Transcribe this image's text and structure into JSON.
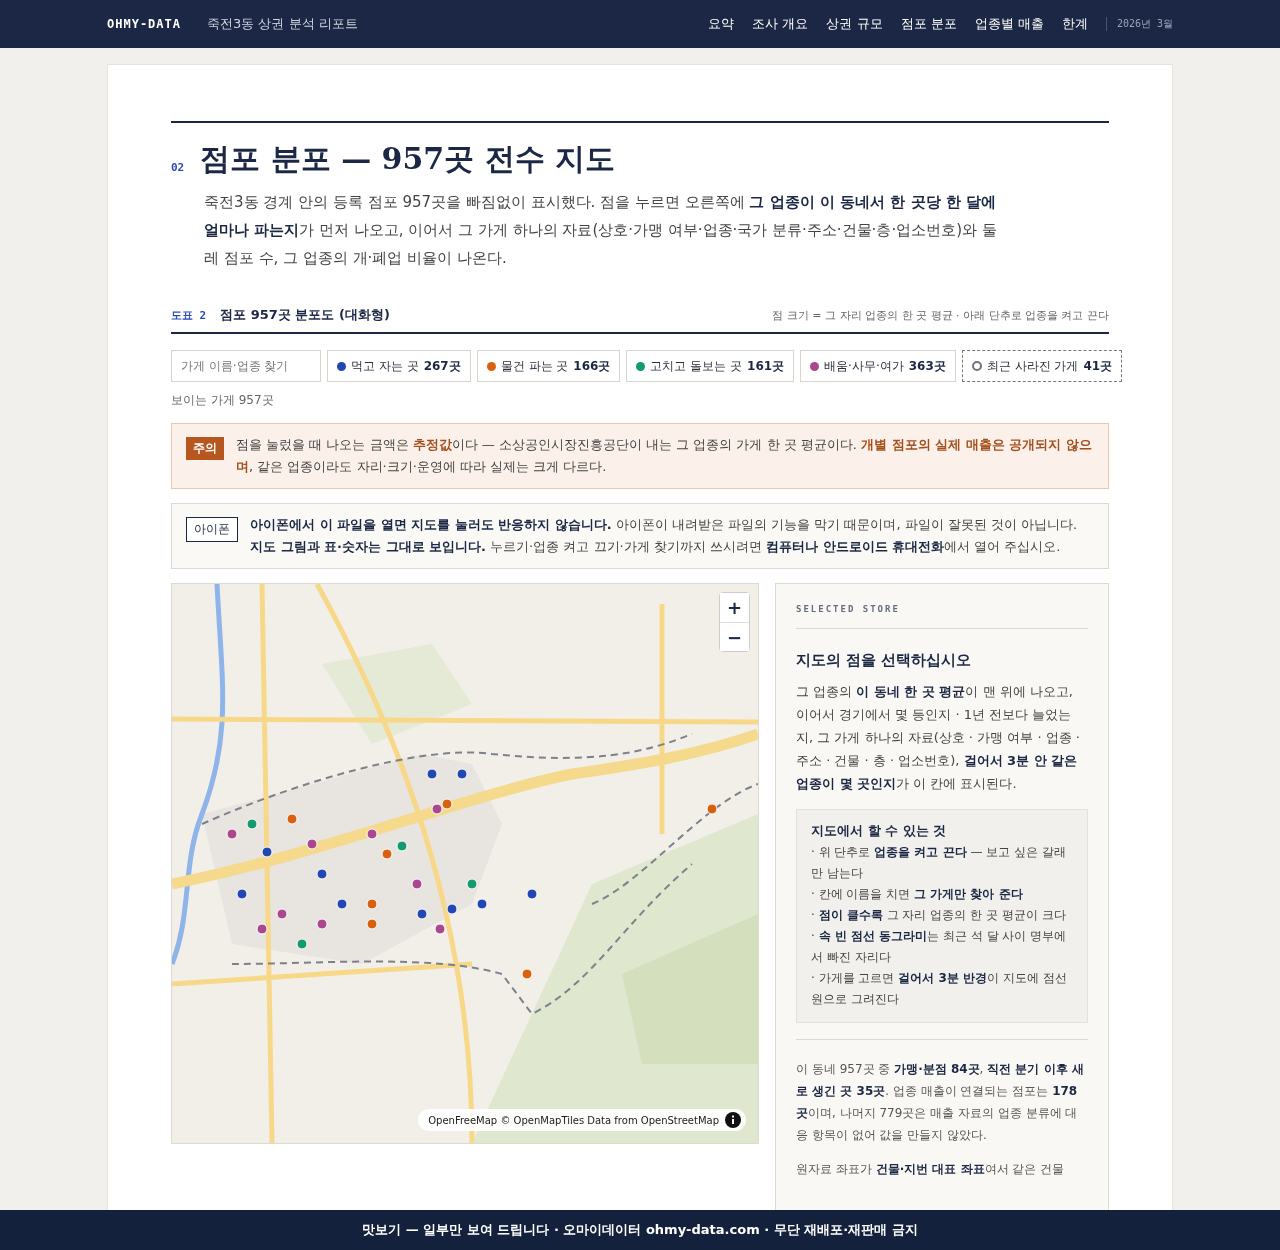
{
  "header": {
    "brand": "OHMY-DATA",
    "subtitle": "죽전3동 상권 분석 리포트",
    "nav": [
      {
        "label": "요약",
        "selected": false
      },
      {
        "label": "조사 개요",
        "selected": false
      },
      {
        "label": "상권 규모",
        "selected": false
      },
      {
        "label": "점포 분포",
        "selected": false
      },
      {
        "label": "업종별 매출",
        "selected": false
      },
      {
        "label": "한계",
        "selected": false
      }
    ],
    "date": "2026년 3월"
  },
  "section": {
    "number": "02",
    "title": "점포 분포 — 957곳 전수 지도",
    "intro": "죽전3동 경계 안의 등록 점포 957곳을 빠짐없이 표시했다. 점을 누르면 오른쪽에 **그 업종이 이 동네서 한 곳당 한 달에 얼마나 파는지**가 먼저 나오고, 이어서 그 가게 하나의 자료(상호·가맹 여부·업종·국가 분류·주소·건물·층·업소번호)와 둘레 점포 수, 그 업종의 개·폐업 비율이 나온다."
  },
  "figure": {
    "label": "도표 2",
    "title": "점포 957곳 분포도 (대화형)",
    "note": "점 크기 = 그 자리 업종의 한 곳 평균 · 아래 단추로 업종을 켜고 끈다"
  },
  "filters": {
    "search": {
      "placeholder": "가게 이름·업종 찾기"
    },
    "chips": [
      {
        "kind": "category",
        "label": "먹고 자는 곳",
        "count": "267곳",
        "color": "#2346b5",
        "on": true
      },
      {
        "kind": "category",
        "label": "물건 파는 곳",
        "count": "166곳",
        "color": "#d9600f",
        "on": true
      },
      {
        "kind": "category",
        "label": "고치고 돌보는 곳",
        "count": "161곳",
        "color": "#139a6e",
        "on": true
      },
      {
        "kind": "category",
        "label": "배움·사무·여가",
        "count": "363곳",
        "color": "#a9478f",
        "on": true
      },
      {
        "kind": "closed",
        "label": "최근 사라진 가게",
        "count": "41곳",
        "color": "#6b7280",
        "on": false
      }
    ],
    "visible": "보이는 가게 957곳"
  },
  "notices": [
    {
      "kind": "caution",
      "badge": "주의",
      "text": "점을 눌렀을 때 나오는 금액은 **추정값**이다 — 소상공인시장진흥공단이 내는 그 업종의 가게 한 곳 평균이다. **개별 점포의 실제 매출은 공개되지 않으며**, 같은 업종이라도 자리·크기·운영에 따라 실제는 크게 다르다."
    },
    {
      "kind": "info",
      "badge": "아이폰",
      "text": "**아이폰에서 이 파일을 열면 지도를 눌러도 반응하지 않습니다.** 아이폰이 내려받은 파일의 기능을 막기 때문이며, 파일이 잘못된 것이 아닙니다. **지도 그림과 표·숫자는 그대로 보입니다.** 누르기·업종 켜고 끄기·가게 찾기까지 쓰시려면 **컴퓨터나 안드로이드 휴대전화**에서 열어 주십시오."
    }
  ],
  "map": {
    "zoom_in": "+",
    "zoom_out": "−",
    "attribution": "OpenFreeMap © OpenMapTiles Data from OpenStreetMap"
  },
  "panel": {
    "eyebrow": "SELECTED STORE",
    "heading": "지도의 점을 선택하십시오",
    "body": "그 업종의 **이 동네 한 곳 평균**이 맨 위에 나오고, 이어서 경기에서 몇 등인지 · 1년 전보다 늘었는지, 그 가게 하나의 자료(상호 · 가맹 여부 · 업종 · 주소 · 건물 · 층 · 업소번호), **걸어서 3분 안 같은 업종이 몇 곳인지**가 이 칸에 표시된다.",
    "tips": {
      "title": "지도에서 할 수 있는 것",
      "items": [
        "· 위 단추로 **업종을 켜고 끈다** — 보고 싶은 갈래만 남는다",
        "· 칸에 이름을 치면 **그 가게만 찾아 준다**",
        "· **점이 클수록** 그 자리 업종의 한 곳 평균이 크다",
        "· **속 빈 점선 동그라미**는 최근 석 달 사이 명부에서 빠진 자리다",
        "· 가게를 고르면 **걸어서 3분 반경**이 지도에 점선 원으로 그려진다"
      ]
    },
    "summary": "이 동네 957곳 중 **가맹·분점 84곳**, **직전 분기 이후 새로 생긴 곳 35곳**. 업종 매출이 연결되는 점포는 **178곳**이며, 나머지 779곳은 매출 자료의 업종 분류에 대응 항목이 없어 값을 만들지 않았다.",
    "note": "원자료 좌표가 **건물·지번 대표 좌표**여서 같은 건물"
  },
  "banner": "맛보기 — 일부만 보여 드립니다 · 오마이데이터 ohmy-data.com · 무단 재배포·재판매 금지"
}
